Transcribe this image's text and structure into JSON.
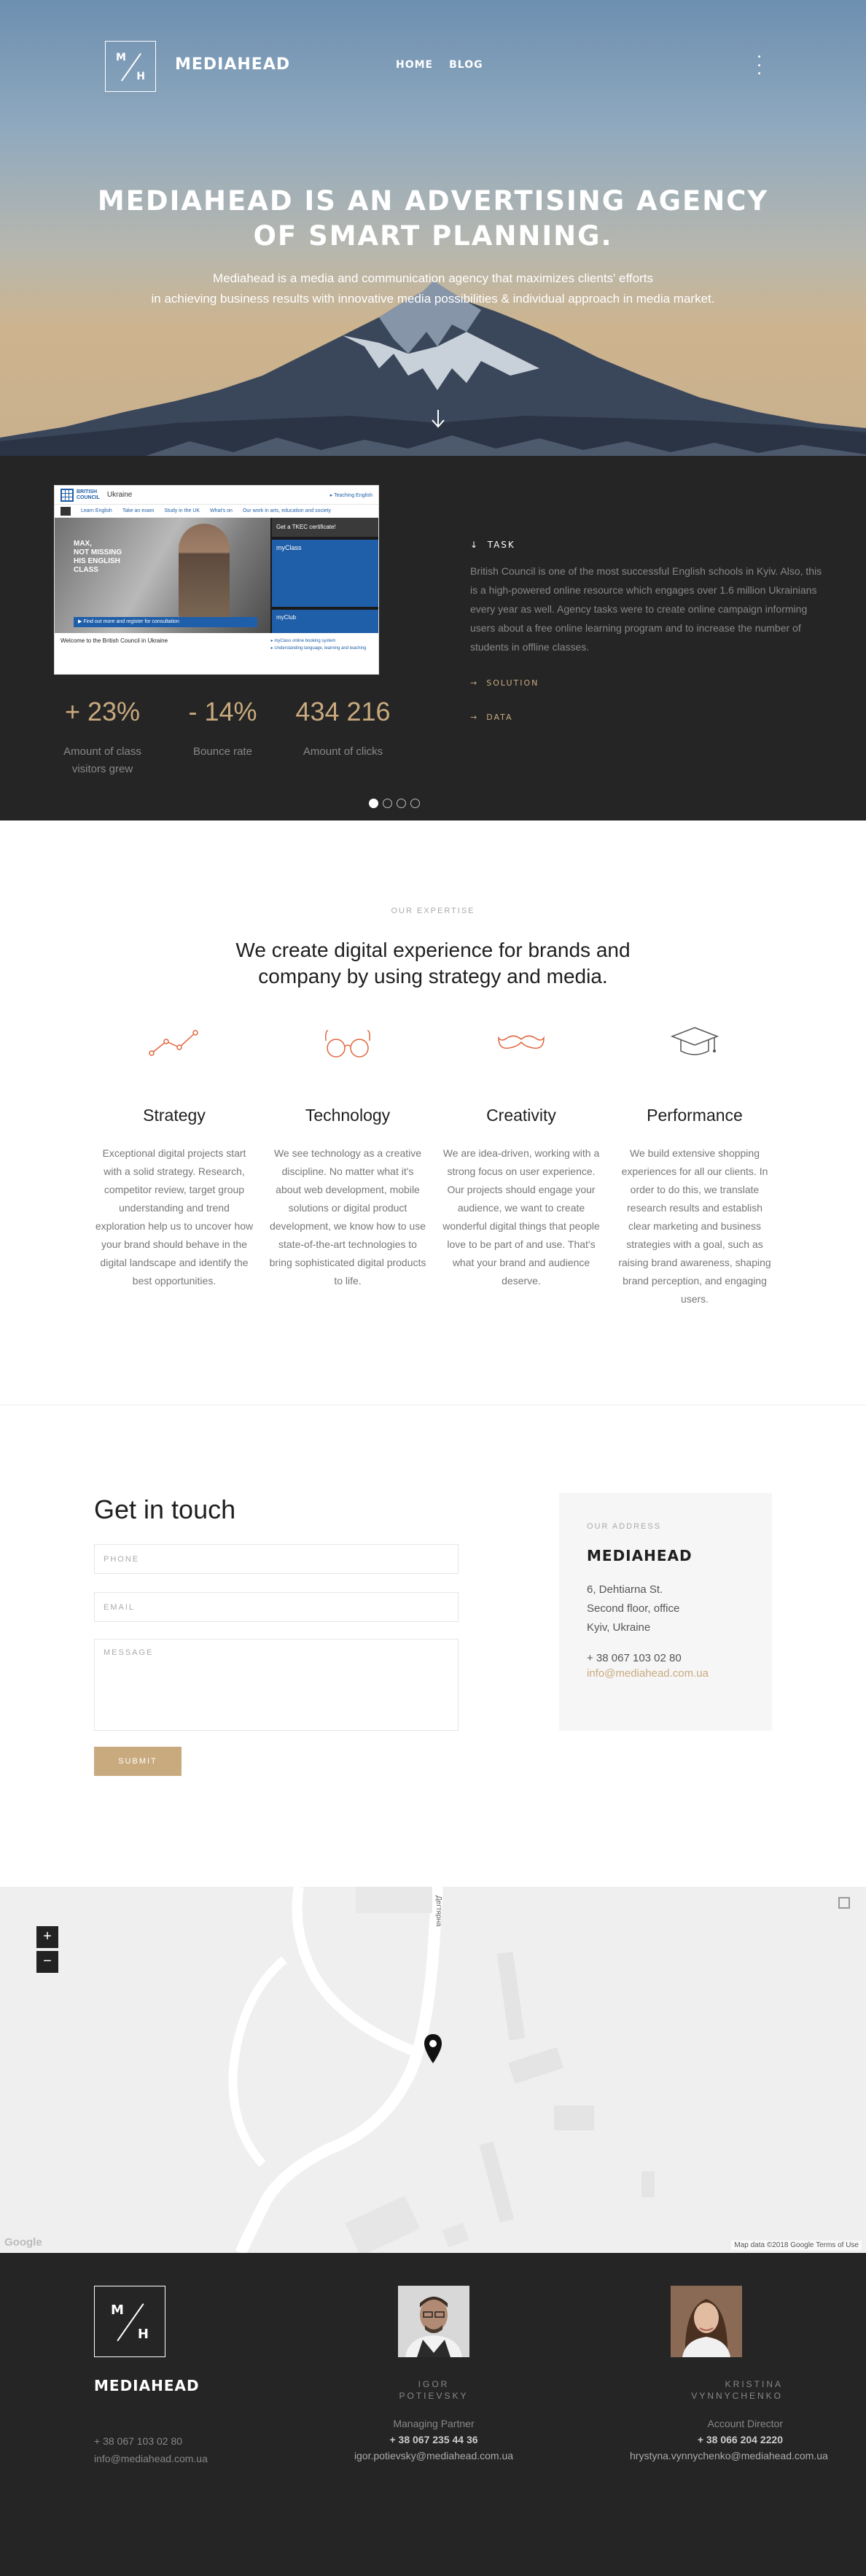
{
  "header": {
    "logo_m": "M",
    "logo_h": "H",
    "brand": "MEDIAHEAD",
    "nav": [
      "HOME",
      "BLOG"
    ],
    "menu_icon": "kebab-menu-icon"
  },
  "hero": {
    "headline_1": "MEDIAHEAD IS AN ADVERTISING AGENCY",
    "headline_2": "OF SMART PLANNING.",
    "sub_1": "Mediahead is a media and communication agency that maximizes clients' efforts",
    "sub_2": "in achieving business results with innovative media possibilities & individual approach in media market.",
    "scroll_icon": "arrow-down-icon"
  },
  "case": {
    "screenshot": {
      "logo_text_1": "BRITISH",
      "logo_text_2": "COUNCIL",
      "country": "Ukraine",
      "teach": "▸ Teaching English",
      "nav": [
        "Learn English",
        "Take an exam",
        "Study in the UK",
        "What's on",
        "Our work in arts, education and society"
      ],
      "headline": "MAX,\nNOT MISSING\nHIS ENGLISH\nCLASS",
      "cta": "▶ Find out more and register for consultation",
      "side_1": "Get a TKEC certificate!",
      "side_2": "myClass",
      "side_3": "myClub",
      "welcome": "Welcome to the British Council in Ukraine",
      "side_links": "▸ myClass online booking system\n▸ Understanding language, learning and teaching"
    },
    "stats": [
      {
        "value": "+ 23%",
        "label": "Amount of class visitors grew"
      },
      {
        "value": "- 14%",
        "label": "Bounce rate"
      },
      {
        "value": "434 216",
        "label": "Amount of clicks"
      }
    ],
    "task_title": "TASK",
    "task_body": "British Council is one of the most successful English schools in Kyiv. Also, this is a high-powered online resource which engages over 1.6 million Ukrainians every year as well. Agency tasks were to create online campaign informing users about a free online learning program and to increase the number of students in offline classes.",
    "solution_label": "SOLUTION",
    "data_label": "DATA",
    "pager_count": 4,
    "pager_active": 0
  },
  "expertise": {
    "label": "OUR EXPERTISE",
    "title_1": "We create digital experience for brands and",
    "title_2": "company by using strategy and media.",
    "accent": "#e0663d",
    "items": [
      {
        "icon": "line-chart-icon",
        "title": "Strategy",
        "text": "Exceptional digital projects start with a solid strategy. Research, competitor review, target group understanding and trend exploration help us to uncover how your brand should behave in the digital landscape and identify the best opportunities."
      },
      {
        "icon": "glasses-icon",
        "title": "Technology",
        "text": "We see technology as a creative discipline. No matter what it's about web development, mobile solutions or digital product development, we know how to use state-of-the-art technologies to bring sophisticated digital products to life."
      },
      {
        "icon": "mustache-icon",
        "title": "Creativity",
        "text": "We are idea-driven, working with a strong focus on user experience. Our projects should engage your audience, we want to create wonderful digital things that people love to be part of and use. That's what your brand and audience deserve."
      },
      {
        "icon": "graduation-cap-icon",
        "title": "Performance",
        "text": "We build extensive shopping experiences for all our clients. In order to do this, we translate research results and establish clear marketing and business strategies with a goal, such as raising brand awareness, shaping brand perception, and engaging users."
      }
    ]
  },
  "contact": {
    "title": "Get in touch",
    "phone_placeholder": "PHONE",
    "email_placeholder": "EMAIL",
    "message_placeholder": "MESSAGE",
    "submit": "SUBMIT",
    "card_label": "OUR ADDRESS",
    "card_name": "MEDIAHEAD",
    "address_1": "6, Dehtiarna St.",
    "address_2": "Second floor, office",
    "address_3": "Kyiv, Ukraine",
    "phone": "+ 38 067 103 02 80",
    "email": "info@mediahead.com.ua"
  },
  "map": {
    "zoom_in": "+",
    "zoom_out": "−",
    "street": "Дегтярна",
    "google": "Google",
    "terms": "Map data ©2018 Google    Terms of Use"
  },
  "footer": {
    "logo_m": "M",
    "logo_h": "H",
    "brand": "MEDIAHEAD",
    "phone": "+ 38 067 103 02 80",
    "email": "info@mediahead.com.ua",
    "people": [
      {
        "name_1": "IGOR",
        "name_2": "POTIEVSKY",
        "role": "Managing Partner",
        "phone": "+ 38 067 235 44 36",
        "email": "igor.potievsky@mediahead.com.ua"
      },
      {
        "name_1": "KRISTINA",
        "name_2": "VYNNYCHENKO",
        "role": "Account Director",
        "phone": "+ 38 066 204 2220",
        "email": "hrystyna.vynnychenko@mediahead.com.ua"
      }
    ]
  }
}
